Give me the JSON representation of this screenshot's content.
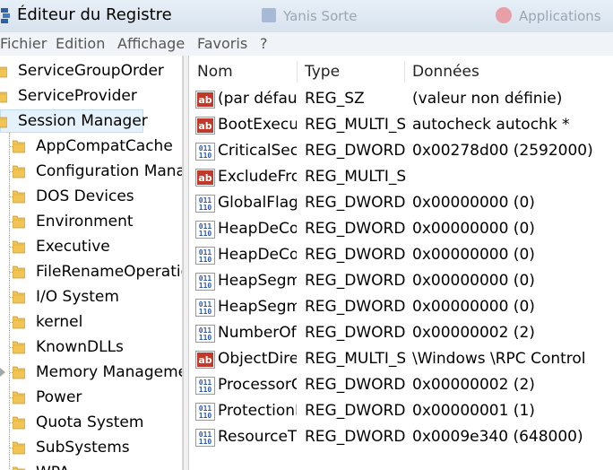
{
  "window": {
    "title": "Éditeur du Registre",
    "background_tabs": [
      "Yanis Sorte",
      "Applications"
    ]
  },
  "menu": [
    "Fichier",
    "Edition",
    "Affichage",
    "Favoris",
    "?"
  ],
  "tree": {
    "items": [
      {
        "label": "ServiceGroupOrder",
        "level": 0
      },
      {
        "label": "ServiceProvider",
        "level": 0
      },
      {
        "label": "Session Manager",
        "level": 0,
        "selected": true
      },
      {
        "label": "AppCompatCache",
        "level": 1
      },
      {
        "label": "Configuration Manager",
        "level": 1
      },
      {
        "label": "DOS Devices",
        "level": 1
      },
      {
        "label": "Environment",
        "level": 1
      },
      {
        "label": "Executive",
        "level": 1
      },
      {
        "label": "FileRenameOperations",
        "level": 1
      },
      {
        "label": "I/O System",
        "level": 1
      },
      {
        "label": "kernel",
        "level": 1
      },
      {
        "label": "KnownDLLs",
        "level": 1
      },
      {
        "label": "Memory Management",
        "level": 1,
        "expandable": true
      },
      {
        "label": "Power",
        "level": 1
      },
      {
        "label": "Quota System",
        "level": 1
      },
      {
        "label": "SubSystems",
        "level": 1
      },
      {
        "label": "WPA",
        "level": 1
      }
    ]
  },
  "list": {
    "headers": [
      "Nom",
      "Type",
      "Données"
    ],
    "rows": [
      {
        "icon": "ab",
        "name": "(par défaut)",
        "type": "REG_SZ",
        "data": "(valeur non définie)"
      },
      {
        "icon": "ab",
        "name": "BootExecute",
        "type": "REG_MULTI_SZ",
        "data": "autocheck autochk *"
      },
      {
        "icon": "bin",
        "name": "CriticalSectionTimeout",
        "type": "REG_DWORD",
        "data": "0x00278d00 (2592000)"
      },
      {
        "icon": "ab",
        "name": "ExcludeFromKnownDlls",
        "type": "REG_MULTI_SZ",
        "data": ""
      },
      {
        "icon": "bin",
        "name": "GlobalFlag",
        "type": "REG_DWORD",
        "data": "0x00000000 (0)"
      },
      {
        "icon": "bin",
        "name": "HeapDeCommitFreeBlockThreshold",
        "type": "REG_DWORD",
        "data": "0x00000000 (0)"
      },
      {
        "icon": "bin",
        "name": "HeapDeCommitTotalFreeThreshold",
        "type": "REG_DWORD",
        "data": "0x00000000 (0)"
      },
      {
        "icon": "bin",
        "name": "HeapSegmentCommit",
        "type": "REG_DWORD",
        "data": "0x00000000 (0)"
      },
      {
        "icon": "bin",
        "name": "HeapSegmentReserve",
        "type": "REG_DWORD",
        "data": "0x00000000 (0)"
      },
      {
        "icon": "bin",
        "name": "NumberOfInitialSessions",
        "type": "REG_DWORD",
        "data": "0x00000002 (2)"
      },
      {
        "icon": "ab",
        "name": "ObjectDirectories",
        "type": "REG_MULTI_SZ",
        "data": "\\Windows \\RPC Control"
      },
      {
        "icon": "bin",
        "name": "ProcessorControl",
        "type": "REG_DWORD",
        "data": "0x00000002 (2)"
      },
      {
        "icon": "bin",
        "name": "ProtectionMode",
        "type": "REG_DWORD",
        "data": "0x00000001 (1)"
      },
      {
        "icon": "bin",
        "name": "ResourceTimeoutCount",
        "type": "REG_DWORD",
        "data": "0x0009e340 (648000)"
      }
    ]
  },
  "colors": {
    "selection": "#e5f1fb",
    "folder": "#f1c453",
    "string_icon": "#c0392b",
    "binary_icon": "#2c5aa8"
  }
}
